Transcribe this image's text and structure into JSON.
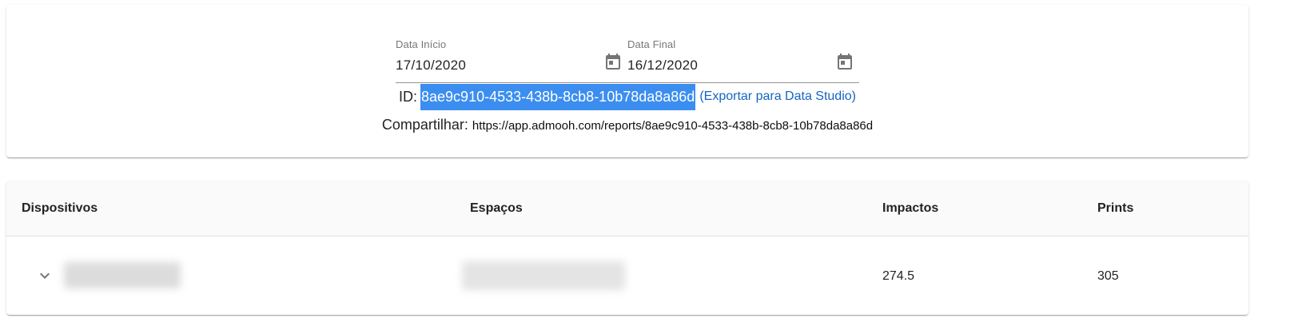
{
  "filters": {
    "start_date": {
      "label": "Data Início",
      "value": "17/10/2020",
      "icon": "calendar-icon"
    },
    "end_date": {
      "label": "Data Final",
      "value": "16/12/2020",
      "icon": "calendar-icon"
    }
  },
  "report": {
    "id_label": "ID:",
    "id_value": "8ae9c910-4533-438b-8cb8-10b78da8a86d",
    "export_link": "(Exportar para Data Studio)",
    "share_label": "Compartilhar:",
    "share_url": "https://app.admooh.com/reports/8ae9c910-4533-438b-8cb8-10b78da8a86d"
  },
  "table": {
    "columns": [
      "Dispositivos",
      "Espaços",
      "Impactos",
      "Prints"
    ],
    "rows": [
      {
        "dispositivo": "",
        "espaco": "",
        "impactos": "274.5",
        "prints": "305",
        "expand_icon": "chevron-down-icon"
      }
    ]
  },
  "colors": {
    "selection_highlight": "#3b8ef0",
    "link": "#1565c0",
    "header_bg": "#fafafa"
  }
}
